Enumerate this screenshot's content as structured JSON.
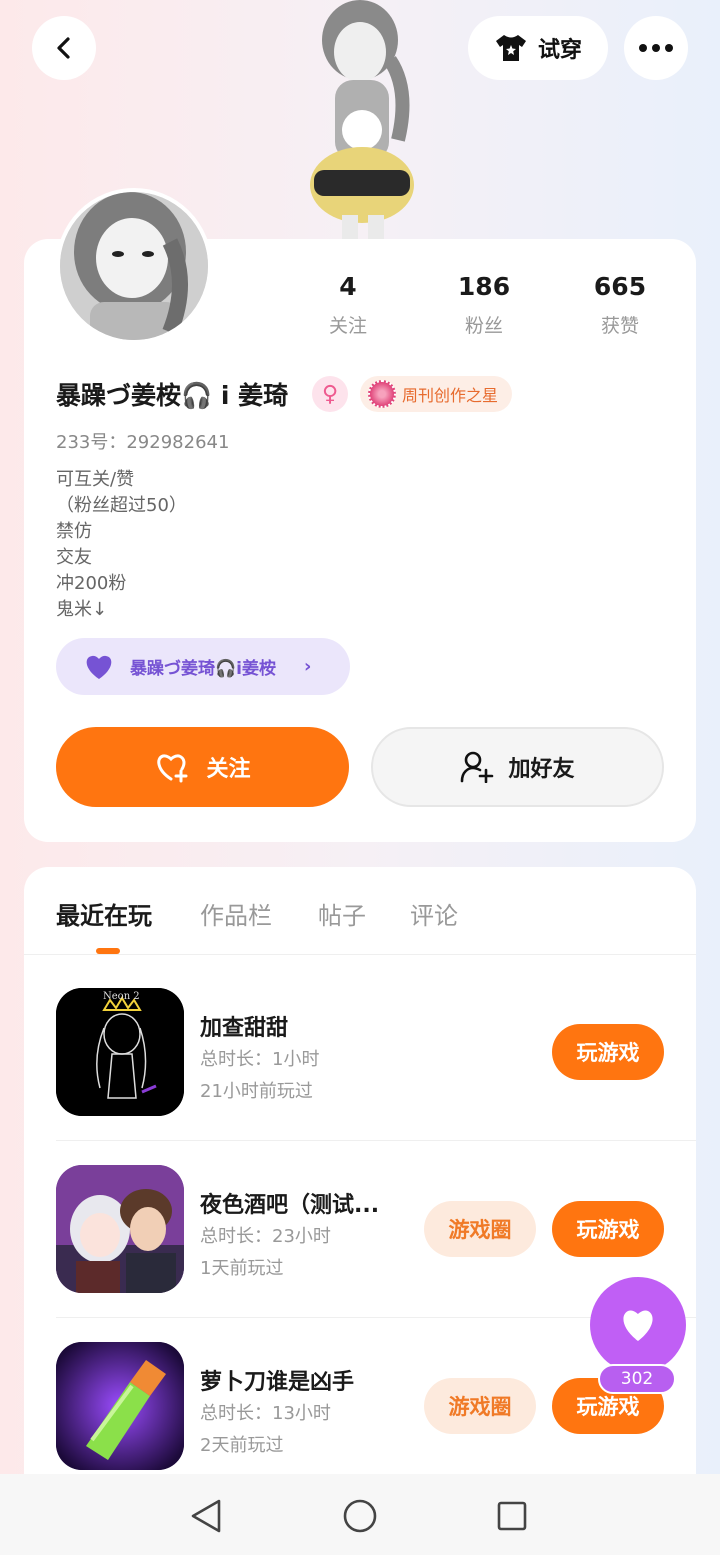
{
  "header": {
    "tryon_label": "试穿"
  },
  "profile": {
    "stats": [
      {
        "value": "4",
        "label": "关注"
      },
      {
        "value": "186",
        "label": "粉丝"
      },
      {
        "value": "665",
        "label": "获赞"
      }
    ],
    "username": "暴躁づ姜桉🎧 i 姜琦",
    "badge_label": "周刊创作之星",
    "uid": "233号：292982641",
    "bio": [
      "可互关/赞",
      "（粉丝超过50）",
      "禁仿",
      "交友",
      "冲200粉",
      "鬼米↓"
    ],
    "circle_tag": "暴躁づ姜琦🎧i姜桉",
    "follow_label": "关注",
    "add_friend_label": "加好友"
  },
  "tabs": [
    {
      "label": "最近在玩",
      "active": true
    },
    {
      "label": "作品栏",
      "active": false
    },
    {
      "label": "帖子",
      "active": false
    },
    {
      "label": "评论",
      "active": false
    }
  ],
  "games": [
    {
      "name": "加查甜甜",
      "duration": "总时长：1小时",
      "last_played": "21小时前玩过",
      "icon_text": "Neon 2",
      "has_circle": false,
      "play_label": "玩游戏"
    },
    {
      "name": "夜色酒吧（测试...",
      "duration": "总时长：23小时",
      "last_played": "1天前玩过",
      "has_circle": true,
      "circle_label": "游戏圈",
      "play_label": "玩游戏"
    },
    {
      "name": "萝卜刀谁是凶手",
      "duration": "总时长：13小时",
      "last_played": "2天前玩过",
      "has_circle": true,
      "circle_label": "游戏圈",
      "play_label": "玩游戏"
    }
  ],
  "like_fab": {
    "count": "302"
  },
  "colors": {
    "accent": "#ff7510",
    "purple": "#c05ff5",
    "tag_bg": "#ebe6fb"
  },
  "icons": [
    "back-icon",
    "shirt-icon",
    "more-icon",
    "female-icon",
    "medal-icon",
    "heart-icon",
    "heart-plus-icon",
    "add-user-icon",
    "chevron-right-icon",
    "nav-back-icon",
    "nav-home-icon",
    "nav-recent-icon"
  ]
}
